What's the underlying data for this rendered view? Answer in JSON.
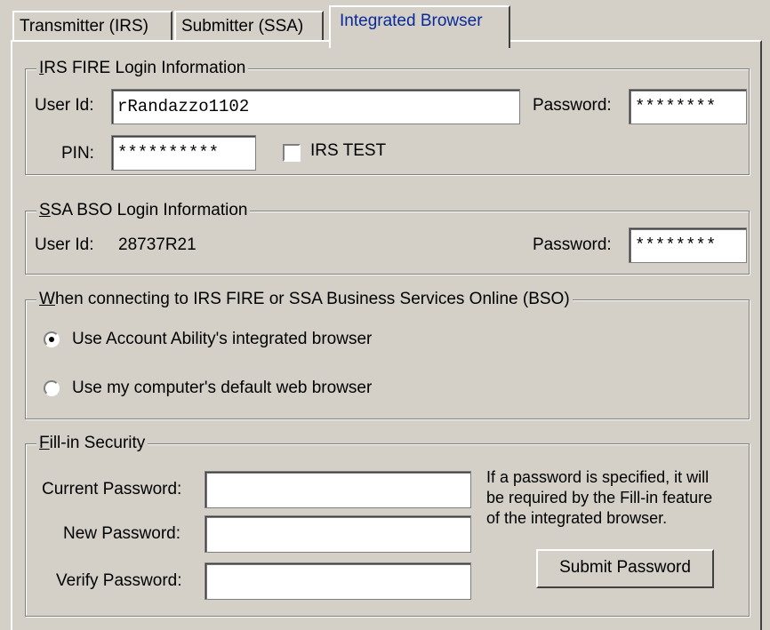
{
  "tabs": [
    {
      "label": "Transmitter (IRS)"
    },
    {
      "label": "Submitter (SSA)"
    },
    {
      "label": "Integrated Browser"
    }
  ],
  "irs": {
    "legend_first": "I",
    "legend_rest": "RS FIRE Login Information",
    "user_id_label": "User Id:",
    "user_id_value": "rRandazzo1102",
    "password_label": "Password:",
    "password_value": "********",
    "pin_label": "PIN:",
    "pin_value": "**********",
    "test_label": "IRS TEST",
    "test_checked": false
  },
  "ssa": {
    "legend_first": "S",
    "legend_rest": "SA BSO Login Information",
    "user_id_label": "User Id:",
    "user_id_value": "28737R21",
    "password_label": "Password:",
    "password_value": "********"
  },
  "connect": {
    "legend_first": "W",
    "legend_rest": "hen connecting to IRS FIRE or SSA Business Services Online (BSO)",
    "option1": "Use Account Ability's integrated browser",
    "option2": "Use my computer's default web browser",
    "selected": "option1"
  },
  "fill_in": {
    "legend_first": "F",
    "legend_rest": "ill-in Security",
    "current_label": "Current Password:",
    "new_label": "New Password:",
    "verify_label": "Verify Password:",
    "current_value": "",
    "new_value": "",
    "verify_value": "",
    "note_line1": "If a password is specified, it will",
    "note_line2": "be required by the Fill-in feature",
    "note_line3": "of the integrated browser.",
    "submit_label": "Submit Password"
  }
}
